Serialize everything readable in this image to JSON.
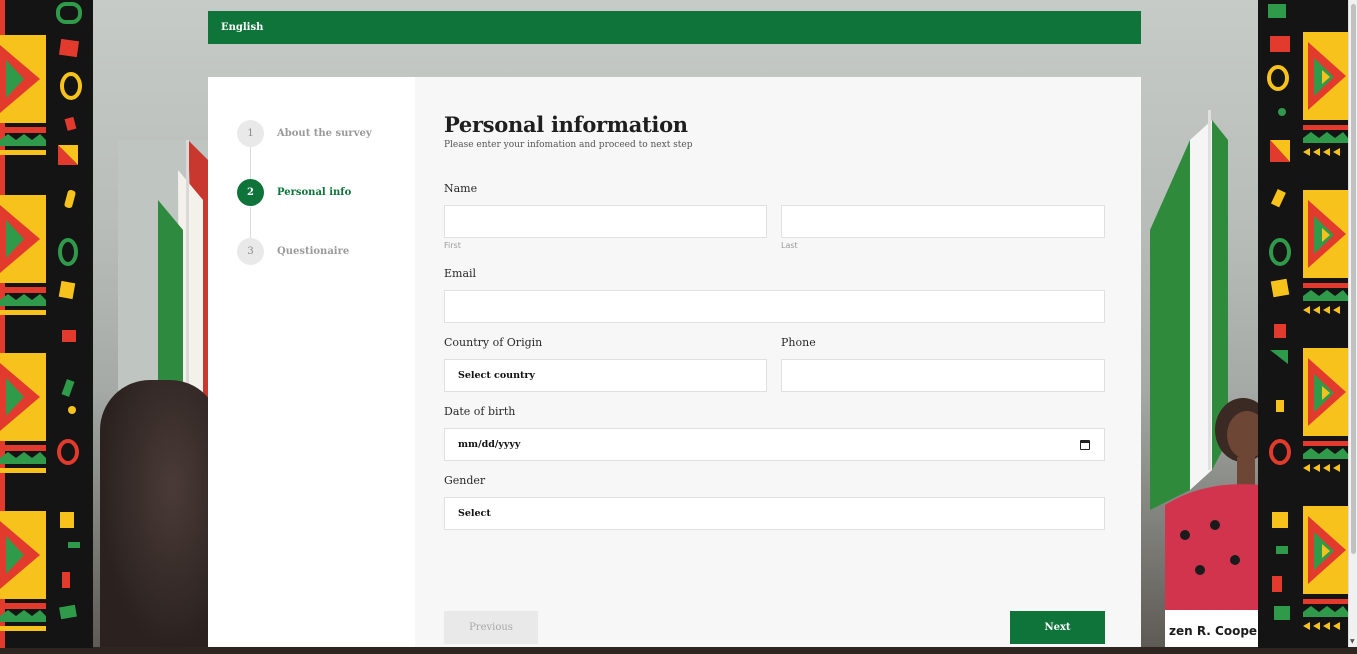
{
  "language": {
    "label": "English"
  },
  "steps": [
    {
      "number": "1",
      "label": "About the survey",
      "active": false
    },
    {
      "number": "2",
      "label": "Personal info",
      "active": true
    },
    {
      "number": "3",
      "label": "Questionaire",
      "active": false
    }
  ],
  "form": {
    "title": "Personal information",
    "subtitle": "Please enter your infomation and proceed to next step",
    "name": {
      "label": "Name",
      "first_sublabel": "First",
      "last_sublabel": "Last",
      "first_value": "",
      "last_value": ""
    },
    "email": {
      "label": "Email",
      "value": ""
    },
    "country": {
      "label": "Country of Origin",
      "selected": "Select country"
    },
    "phone": {
      "label": "Phone",
      "value": ""
    },
    "dob": {
      "label": "Date of birth",
      "placeholder": "mm/dd/yyyy"
    },
    "gender": {
      "label": "Gender",
      "selected": "Select"
    }
  },
  "buttons": {
    "previous": "Previous",
    "next": "Next"
  },
  "background_caption": "zen R. Cooper",
  "colors": {
    "brand_green": "#0e743a",
    "pattern_red": "#e23b2e",
    "pattern_yellow": "#f7c21c",
    "pattern_green": "#2f9a4a"
  }
}
